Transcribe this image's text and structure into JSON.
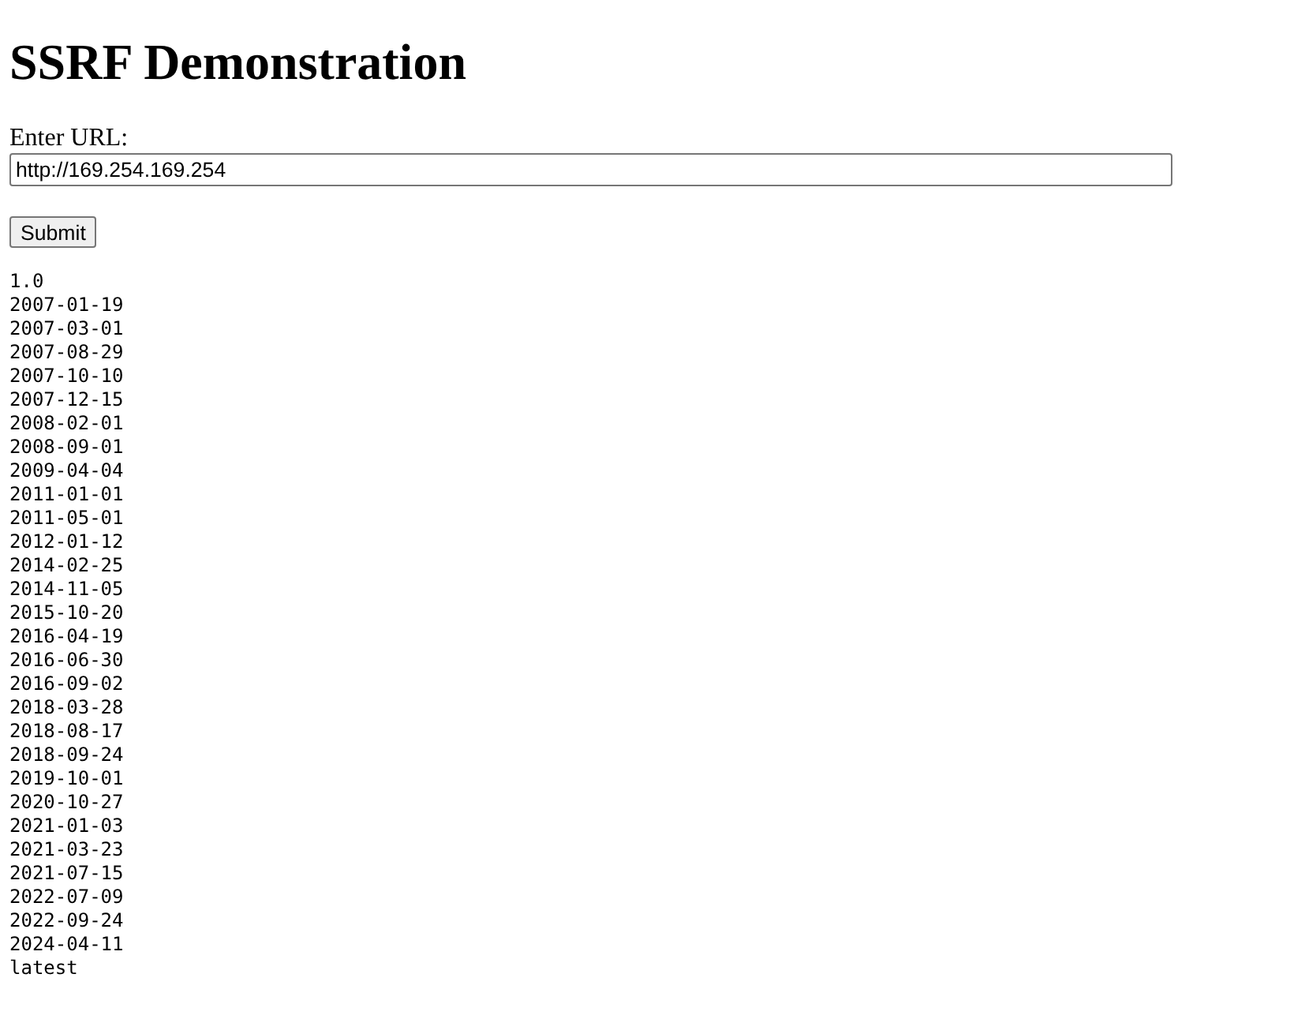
{
  "heading": "SSRF Demonstration",
  "form": {
    "label": "Enter URL:",
    "url_value": "http://169.254.169.254",
    "submit": "Submit"
  },
  "output_lines": [
    "1.0",
    "2007-01-19",
    "2007-03-01",
    "2007-08-29",
    "2007-10-10",
    "2007-12-15",
    "2008-02-01",
    "2008-09-01",
    "2009-04-04",
    "2011-01-01",
    "2011-05-01",
    "2012-01-12",
    "2014-02-25",
    "2014-11-05",
    "2015-10-20",
    "2016-04-19",
    "2016-06-30",
    "2016-09-02",
    "2018-03-28",
    "2018-08-17",
    "2018-09-24",
    "2019-10-01",
    "2020-10-27",
    "2021-01-03",
    "2021-03-23",
    "2021-07-15",
    "2022-07-09",
    "2022-09-24",
    "2024-04-11",
    "latest"
  ]
}
